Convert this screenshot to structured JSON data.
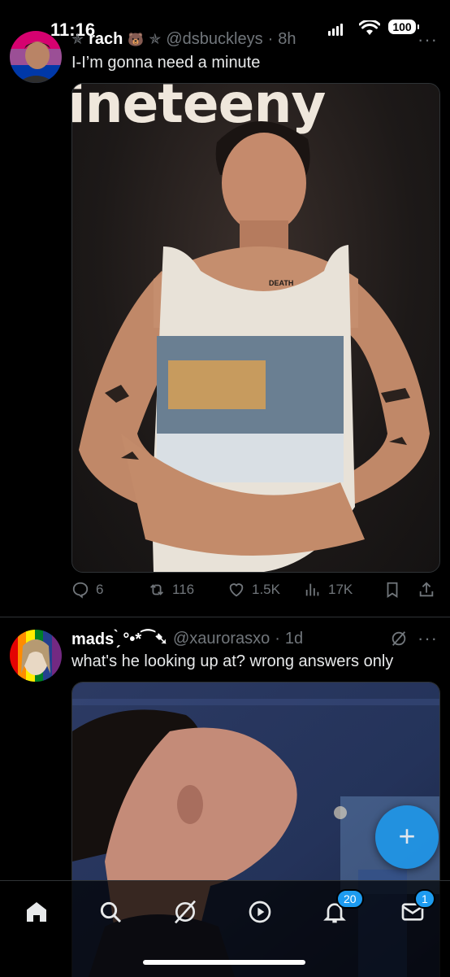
{
  "status_bar": {
    "time": "11:16",
    "battery": "100"
  },
  "tweets": [
    {
      "display_name": "rach",
      "name_emoji": "🐻",
      "handle": "@dsbuckleys",
      "time": "8h",
      "text": "I-I’m gonna need a minute",
      "media_banner": "ineteeny",
      "tattoo_text": "DEATH",
      "stats": {
        "replies": "6",
        "reposts": "116",
        "likes": "1.5K",
        "views": "17K"
      }
    },
    {
      "display_name": "mads ̗̀ °•*⁀➷",
      "handle": "@xaurorasxo",
      "time": "1d",
      "text": "what's he looking up at? wrong answers only"
    }
  ],
  "more_label": "···",
  "fab_label": "+",
  "nav": {
    "notifications_badge": "20",
    "messages_badge": "1"
  },
  "colors": {
    "accent": "#1d9bf0",
    "muted": "#71767b",
    "background": "#000000"
  },
  "icons": [
    "home-icon",
    "search-icon",
    "grok-icon",
    "video-icon",
    "bell-icon",
    "mail-icon",
    "reply-icon",
    "repost-icon",
    "like-icon",
    "views-icon",
    "bookmark-icon",
    "share-icon"
  ]
}
